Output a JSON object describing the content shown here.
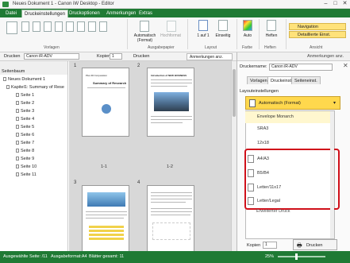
{
  "window": {
    "title": "Neues Dokument 1 - Canon iW Desktop - Editor"
  },
  "tabs": [
    "Datei",
    "Druckeinstellungen",
    "Druckoptionen",
    "Anmerkungen",
    "Extras"
  ],
  "ribbon": {
    "groups": [
      "Vorlagen",
      "Ausgabepapier",
      "Layout",
      "Farbe",
      "Heften",
      "Ansicht"
    ],
    "orient_label": "Automatisch (Format)",
    "orient_label2": "Hochformat",
    "pages_label": "1 auf 1",
    "sided_label": "Einseitig",
    "color_label": "Auto",
    "staple_label": "Heften",
    "nav_label": "Navigation",
    "detail_label": "Detaillierte Einst."
  },
  "toolbar": {
    "printer_label": "Drucken",
    "printer_value": "Canon iR-ADV",
    "copies_label": "Kopien",
    "copies_value": "1",
    "print_button": "Drucken",
    "annot_button": "Anmerkungen anz."
  },
  "left": {
    "header": "Seitenbaum",
    "doc": "Neues Dokument 1",
    "chapter": "Kapitel1: Summary of Rese",
    "pages": [
      "Seite 1",
      "Seite 2",
      "Seite 3",
      "Seite 4",
      "Seite 5",
      "Seite 6",
      "Seite 7",
      "Seite 8",
      "Seite 9",
      "Seite 10",
      "Seite 11"
    ]
  },
  "preview": {
    "page_numbers": [
      "1",
      "2",
      "3",
      "4"
    ],
    "page_labels": [
      "1-1",
      "1-2"
    ],
    "p1_company": "Plus 3D Corporation",
    "p1_title": "Summary of Research",
    "p2_heading": "Introduction of NEW BUSINESS"
  },
  "right": {
    "printer_label": "Druckername:",
    "printer_value": "Canon iR-ADV",
    "subtabs": [
      "Vorlagen",
      "Druckeinst.",
      "Seiteneinst."
    ],
    "section": "Layouteinstellungen",
    "selected": "Automatisch (Format)",
    "items": [
      "Envelope Monarch",
      "SRA3",
      "12x18",
      "A4/A3",
      "B5/B4",
      "Letter/11x17",
      "Letter/Legal",
      "Erweiterter Druck"
    ],
    "copies_label": "Kopien",
    "copies_value": "1",
    "print_button": "Drucken"
  },
  "status": {
    "selected": "Ausgewählte Seite: /11",
    "format": "Ausgabeformat:A4",
    "total": "Blätter gesamt: 11",
    "zoom": "25%"
  },
  "colors": {
    "accent": "#1f7a34",
    "highlight_border": "#d0101a",
    "dropdown_yellow": "#ffd84d"
  }
}
